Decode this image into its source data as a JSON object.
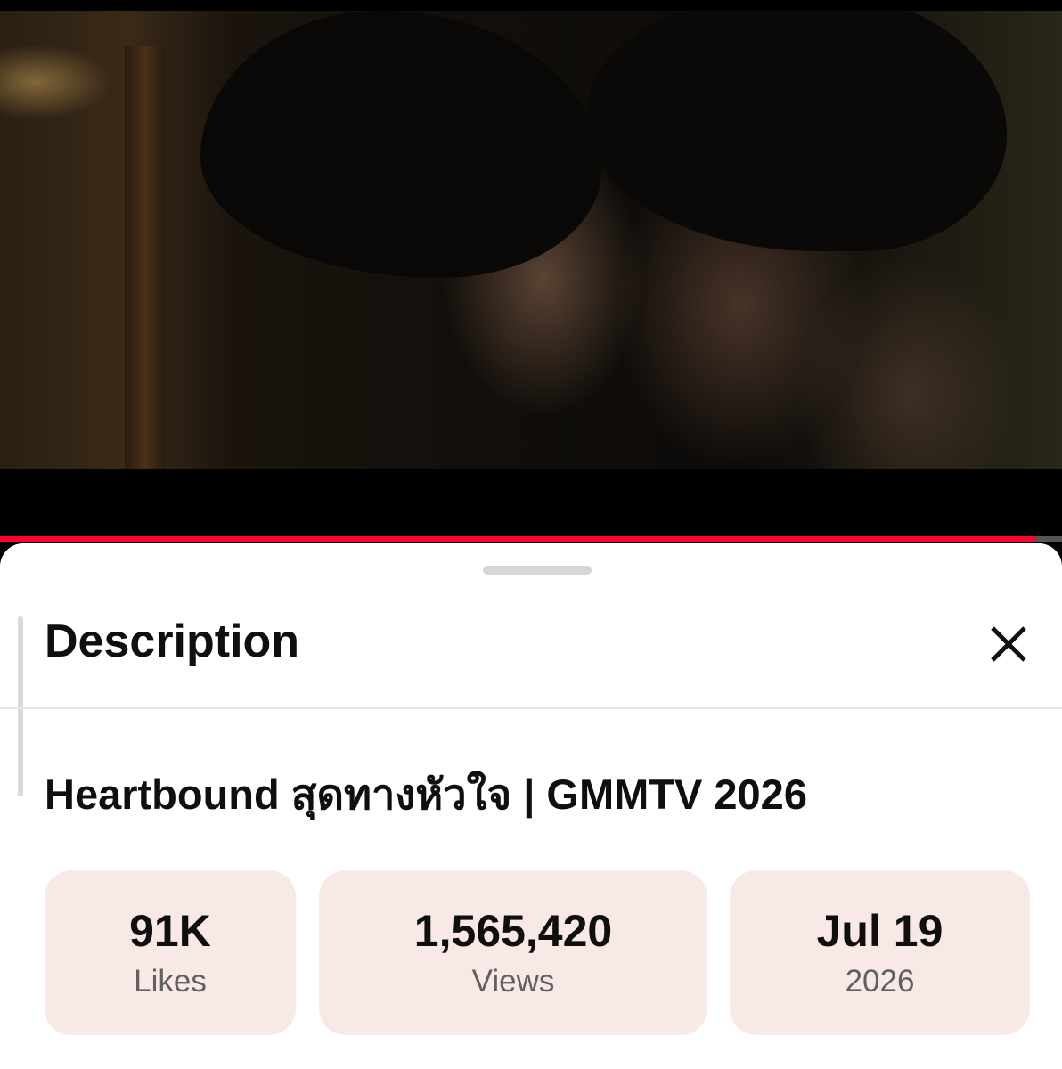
{
  "player": {
    "progress_fraction": 0.975,
    "progress_color": "#ff0033"
  },
  "description_sheet": {
    "title": "Description",
    "close_icon": "close-icon",
    "video_title": "Heartbound สุดทางหัวใจ | GMMTV 2026",
    "stats": {
      "likes": {
        "value": "91K",
        "label": "Likes"
      },
      "views": {
        "value": "1,565,420",
        "label": "Views"
      },
      "date": {
        "value": "Jul 19",
        "label": "2026"
      }
    },
    "stat_card_color": "#f8e9e7"
  }
}
